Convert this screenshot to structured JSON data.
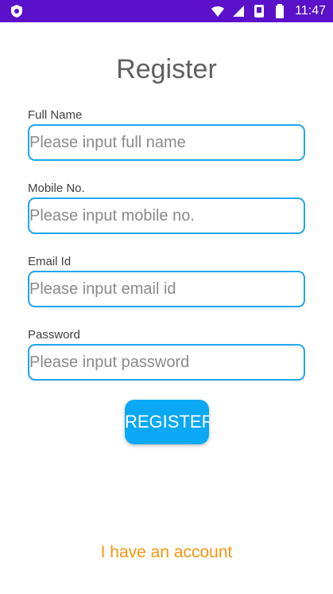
{
  "status_bar": {
    "time": "11:47",
    "icons": [
      "app-shield-icon",
      "wifi-icon",
      "signal-icon",
      "sim-icon",
      "battery-icon"
    ]
  },
  "title": "Register",
  "fields": [
    {
      "label": "Full Name",
      "placeholder": "Please input full name"
    },
    {
      "label": "Mobile No.",
      "placeholder": "Please input mobile no."
    },
    {
      "label": "Email Id",
      "placeholder": "Please input email id"
    },
    {
      "label": "Password",
      "placeholder": "Please input password"
    }
  ],
  "register_button": "REGISTER",
  "account_link": "I have an account",
  "colors": {
    "status_bar": "#5a11c9",
    "input_border": "#1ea6f0",
    "button": "#0aa8f5",
    "link": "#f5960c"
  }
}
